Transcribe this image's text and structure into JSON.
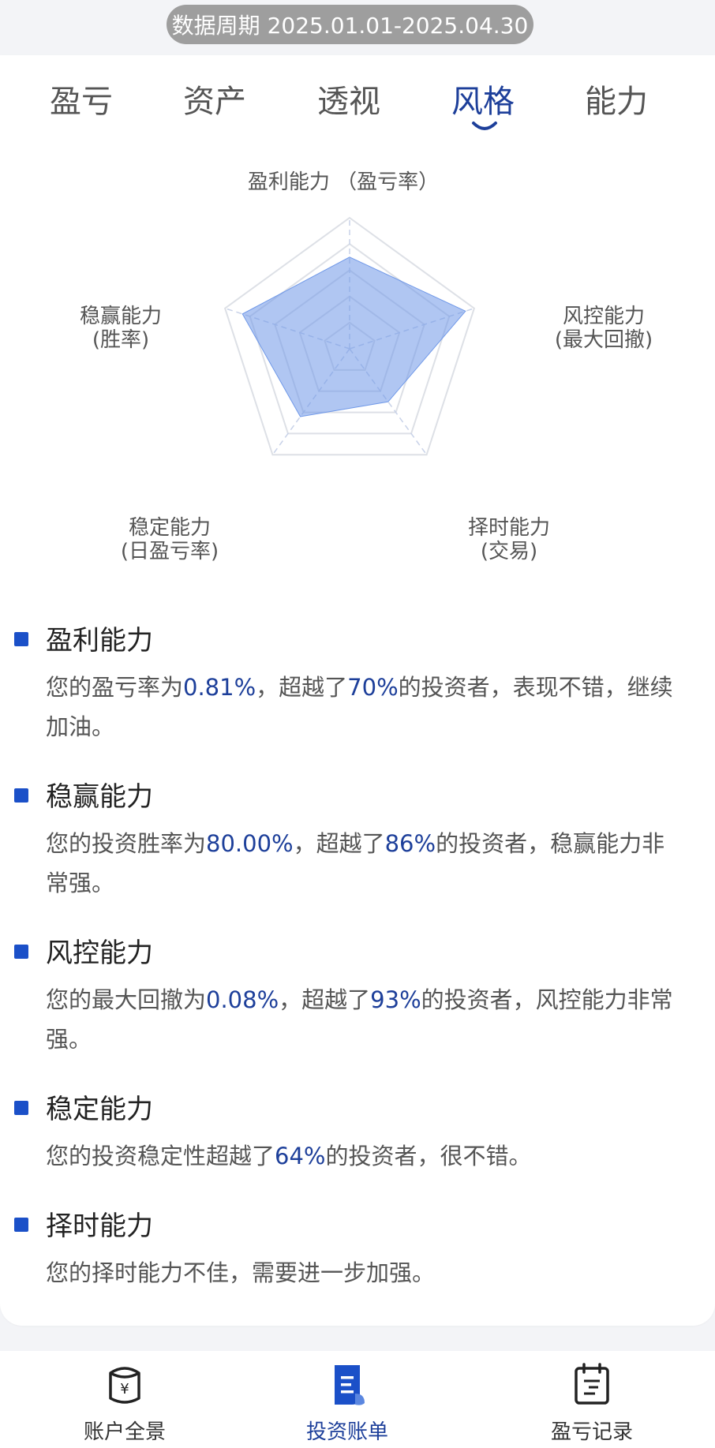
{
  "header": {
    "period_label": "数据周期 2025.01.01-2025.04.30"
  },
  "tabs": [
    {
      "label": "盈亏",
      "active": false
    },
    {
      "label": "资产",
      "active": false
    },
    {
      "label": "透视",
      "active": false
    },
    {
      "label": "风格",
      "active": true
    },
    {
      "label": "能力",
      "active": false
    }
  ],
  "radar": {
    "axes": [
      {
        "line1": "盈利能力 （盈亏率）",
        "line2": ""
      },
      {
        "line1": "风控能力",
        "line2": "(最大回撤)"
      },
      {
        "line1": "择时能力",
        "line2": "(交易)"
      },
      {
        "line1": "稳定能力",
        "line2": "(日盈亏率)"
      },
      {
        "line1": "稳赢能力",
        "line2": "(胜率)"
      }
    ],
    "values": [
      0.7,
      0.93,
      0.5,
      0.64,
      0.86
    ],
    "levels": 5,
    "fill_color": "#6f98e8",
    "grid_color": "#dde0e6"
  },
  "abilities": [
    {
      "title": "盈利能力",
      "desc": [
        {
          "text": "您的盈亏率为"
        },
        {
          "text": "0.81%",
          "hl": true
        },
        {
          "text": "，超越了"
        },
        {
          "text": "70%",
          "hl": true
        },
        {
          "text": "的投资者，表现不错，继续加油。"
        }
      ]
    },
    {
      "title": "稳赢能力",
      "desc": [
        {
          "text": "您的投资胜率为"
        },
        {
          "text": "80.00%",
          "hl": true
        },
        {
          "text": "，超越了"
        },
        {
          "text": "86%",
          "hl": true
        },
        {
          "text": "的投资者，稳赢能力非常强。"
        }
      ]
    },
    {
      "title": "风控能力",
      "desc": [
        {
          "text": "您的最大回撤为"
        },
        {
          "text": "0.08%",
          "hl": true
        },
        {
          "text": "，超越了"
        },
        {
          "text": "93%",
          "hl": true
        },
        {
          "text": "的投资者，风控能力非常强。"
        }
      ]
    },
    {
      "title": "稳定能力",
      "desc": [
        {
          "text": "您的投资稳定性超越了"
        },
        {
          "text": "64%",
          "hl": true
        },
        {
          "text": "的投资者，很不错。"
        }
      ]
    },
    {
      "title": "择时能力",
      "desc": [
        {
          "text": "您的择时能力不佳，需要进一步加强。"
        }
      ]
    }
  ],
  "bottom_nav": [
    {
      "label": "账户全景",
      "icon": "bank-icon",
      "active": false
    },
    {
      "label": "投资账单",
      "icon": "bill-icon",
      "active": true
    },
    {
      "label": "盈亏记录",
      "icon": "calendar-icon",
      "active": false
    }
  ],
  "colors": {
    "accent": "#1d3f9a",
    "marker": "#1b50c8",
    "pill": "#9e9e9e"
  }
}
